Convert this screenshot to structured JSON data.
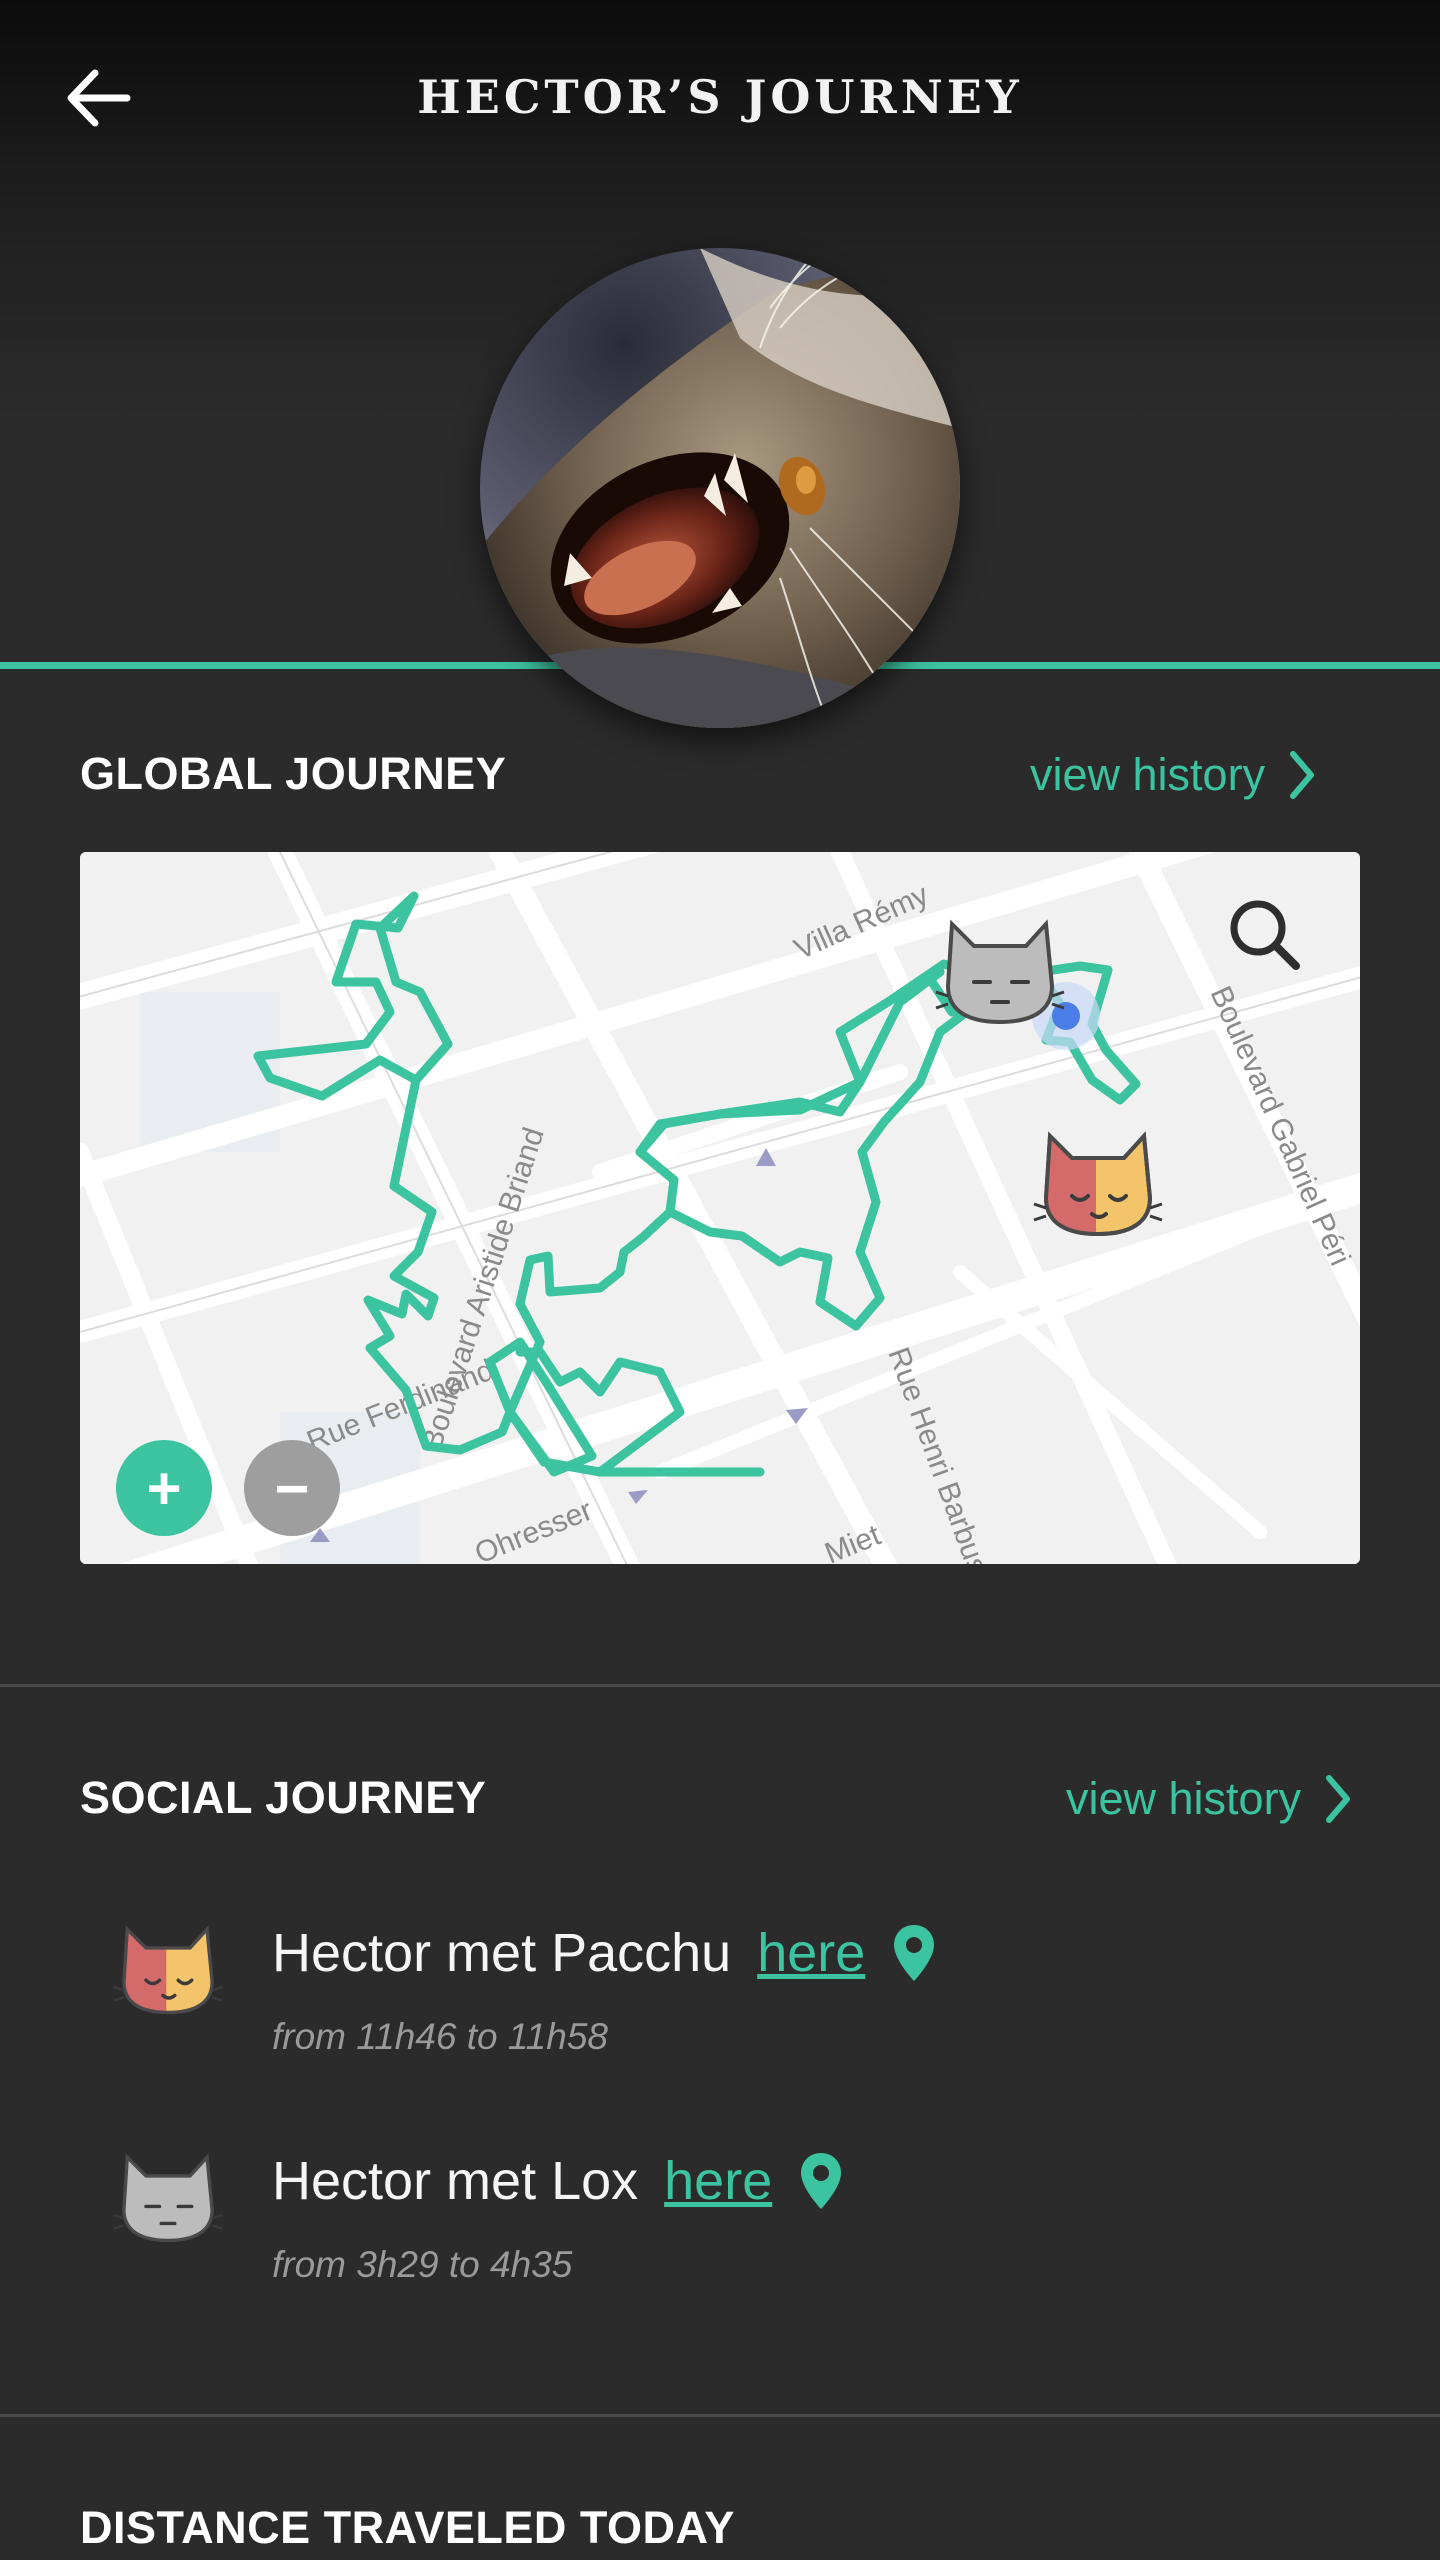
{
  "header": {
    "title": "HECTOR’S JOURNEY",
    "back_icon": "arrow-left-icon"
  },
  "colors": {
    "accent": "#3cc3a0",
    "background": "#2b2b2b",
    "zoom_out": "#9e9e9e"
  },
  "global_journey": {
    "title": "GLOBAL JOURNEY",
    "view_history_label": "view history",
    "map": {
      "street_labels": [
        "Villa Rémy",
        "Boulevard Gabriel Péri",
        "Boulevard Aristide Briand",
        "Rue Ferdinand",
        "Rue Henri Barbusse",
        "Ohresser",
        "Miet"
      ],
      "search_icon": "magnifier-icon",
      "zoom_in_label": "+",
      "zoom_out_label": "−"
    }
  },
  "social_journey": {
    "title": "SOCIAL JOURNEY",
    "view_history_label": "view history",
    "items": [
      {
        "text": "Hector met Pacchu",
        "link": "here",
        "time": "from 11h46 to 11h58",
        "icon": "calico-cat-icon"
      },
      {
        "text": "Hector met Lox",
        "link": "here",
        "time": "from 3h29 to 4h35",
        "icon": "grey-cat-icon"
      }
    ]
  },
  "distance": {
    "title": "DISTANCE TRAVELED TODAY"
  }
}
